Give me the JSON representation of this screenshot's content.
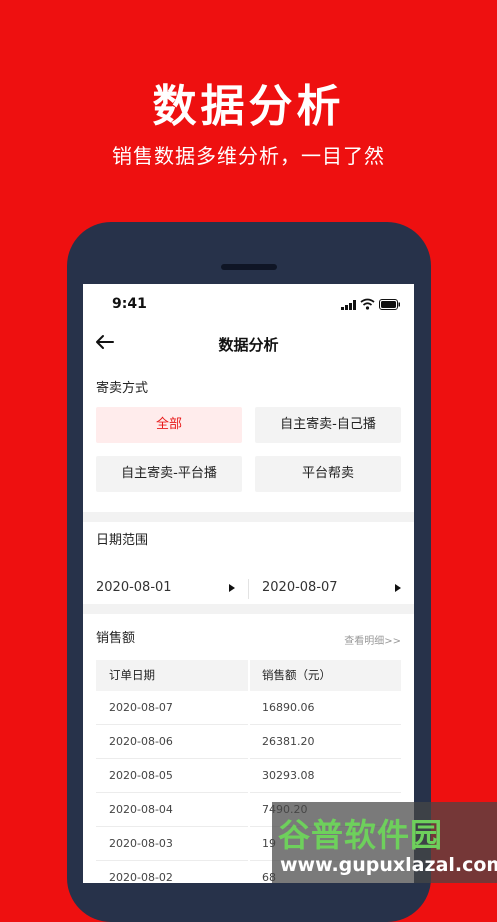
{
  "hero": {
    "title": "数据分析",
    "subtitle": "销售数据多维分析，一目了然"
  },
  "status_bar": {
    "time": "9:41"
  },
  "nav": {
    "title": "数据分析"
  },
  "consign": {
    "title": "寄卖方式",
    "options": [
      "全部",
      "自主寄卖-自己播",
      "自主寄卖-平台播",
      "平台帮卖"
    ],
    "selected": "全部",
    "accent": "#e81a1a"
  },
  "date_range": {
    "title": "日期范围",
    "start": "2020-08-01",
    "end": "2020-08-07"
  },
  "sales": {
    "title": "销售额",
    "view_details": "查看明细>>",
    "columns": [
      "订单日期",
      "销售额（元）"
    ],
    "rows": [
      [
        "2020-08-07",
        "16890.06"
      ],
      [
        "2020-08-06",
        "26381.20"
      ],
      [
        "2020-08-05",
        "30293.08"
      ],
      [
        "2020-08-04",
        "7490.20"
      ],
      [
        "2020-08-03",
        "19"
      ],
      [
        "2020-08-02",
        "68"
      ]
    ]
  },
  "watermark": {
    "name": "谷普软件园",
    "url": "www.gupuxlazal.com"
  },
  "colors": {
    "background": "#ee1010",
    "phone_frame": "#27324a"
  }
}
